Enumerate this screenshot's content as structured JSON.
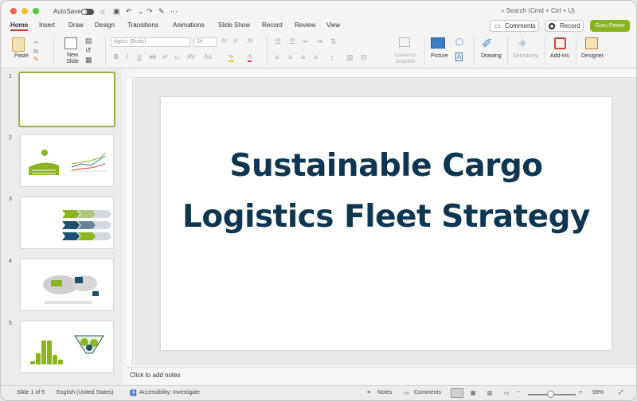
{
  "titlebar": {
    "autosave_label": "AutoSave",
    "more": "···",
    "search_placeholder": "Search (Cmd + Ctrl + U)"
  },
  "tabs": [
    "Home",
    "Insert",
    "Draw",
    "Design",
    "Transitions",
    "Animations",
    "Slide Show",
    "Record",
    "Review",
    "View"
  ],
  "top_buttons": {
    "comments": "Comments",
    "record": "Record",
    "guru": "Guru Power"
  },
  "ribbon": {
    "paste": "Paste",
    "new_slide": "New Slide",
    "font_family": "Aptos (Body)",
    "font_size": "24",
    "convert": "Convert to SmartArt",
    "picture": "Picture",
    "drawing": "Drawing",
    "sensitivity": "Sensitivity",
    "addins": "Add-ins",
    "designer": "Designer"
  },
  "thumbnails": [
    {
      "num": "1"
    },
    {
      "num": "2"
    },
    {
      "num": "3"
    },
    {
      "num": "4"
    },
    {
      "num": "5"
    }
  ],
  "slide": {
    "title": "Sustainable Cargo Logistics Fleet Strategy"
  },
  "notes_placeholder": "Click to add notes",
  "status": {
    "slide_pos": "Slide 1 of 5",
    "language": "English (United States)",
    "accessibility": "Accessibility: Investigate",
    "notes": "Notes",
    "comments": "Comments",
    "zoom": "99%"
  },
  "colors": {
    "accent": "#c04627",
    "brand_green": "#8ab521",
    "title": "#0f3650"
  }
}
